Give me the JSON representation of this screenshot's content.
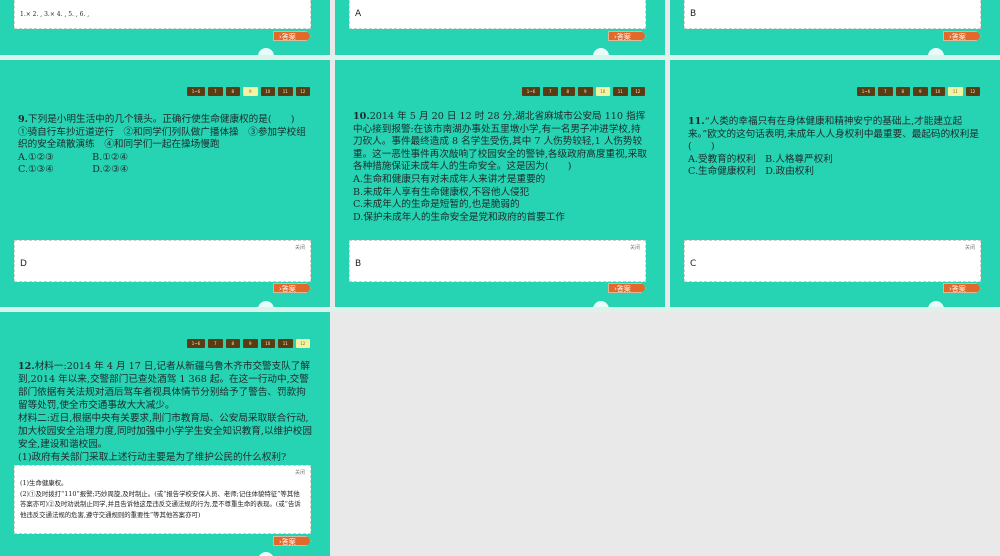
{
  "nav_labels": [
    "1~6",
    "7",
    "8",
    "9",
    "10",
    "11",
    "12"
  ],
  "close_label": "关闭",
  "answer_button": "›答案",
  "top_row": [
    {
      "answer": "1.×   2.  ,  3.×   4.  ,  5.  ,  6.  ,"
    },
    {
      "answer": "A"
    },
    {
      "answer": "B"
    }
  ],
  "slides": [
    {
      "number": "9.",
      "active": 3,
      "lines": [
        "下列是小明生活中的几个镜头。正确行使生命健康权的是(　　)",
        "①骑自行车抄近道逆行　②和同学们列队做广播体操　③参加学校组织的安全疏散演练　④和同学们一起在操场慢跑",
        "A.①②③　　　　B.①②④",
        "C.①③④　　　　D.②③④"
      ],
      "answer": "D"
    },
    {
      "number": "10.",
      "active": 4,
      "lines": [
        "2014 年 5 月 20 日 12 时 28 分,湖北省麻城市公安局 110 指挥中心接到报警:在该市南湖办事处五里墩小学,有一名男子冲进学校,持刀砍人。事件最终造成 8 名学生受伤,其中 7 人伤势较轻,1 人伤势较重。这一恶性事件再次敲响了校园安全的警钟,各级政府高度重视,采取各种措施保证未成年人的生命安全。这是因为(　　)",
        "A.生命和健康只有对未成年人来讲才是重要的",
        "B.未成年人享有生命健康权,不容他人侵犯",
        "C.未成年人的生命是短暂的,也是脆弱的",
        "D.保护未成年人的生命安全是党和政府的首要工作"
      ],
      "answer": "B"
    },
    {
      "number": "11.",
      "active": 5,
      "lines": [
        "“人类的幸福只有在身体健康和精神安宁的基础上,才能建立起来。”欧文的这句话表明,未成年人人身权利中最重要、最起码的权利是(　　)",
        "A.受教育的权利　B.人格尊严权利",
        "C.生命健康权利　D.政由权利"
      ],
      "answer": "C"
    }
  ],
  "slide12": {
    "number": "12.",
    "active": 6,
    "lines": [
      "材料一:2014 年 4 月 17 日,记者从新疆乌鲁木齐市交警支队了解到,2014 年以来,交警部门已查处酒驾 1 368 起。在这一行动中,交警部门依据有关法规对酒后驾车者视具体情节分别给予了警告、罚款拘留等处罚,使全市交通事故大大减少。",
      "材料二:近日,根据中央有关要求,荆门市教育局、公安局采取联合行动,加大校园安全治理力度,同时加强中小学学生安全知识教育,以维护校园安全,建设和谐校园。",
      "(1)政府有关部门采取上述行动主要是为了维护公民的什么权利?"
    ],
    "answer_lines": [
      "(1)生命健康权。",
      "(2)①及时拨打“110”报警;巧妙周旋,及时制止。(或“报告学校安保人员、老师;记住体貌特征”等其他答案亦可)②及时劝说制止同学,并且告诉他这是违反交通法规的行为,是不尊重生命的表现。(或“告诉他违反交通法规的危害,遵守交通规则的重要性”等其他答案亦可)"
    ]
  },
  "colors": {
    "slide_bg": "#26d3b3",
    "nav_bg": "#5b3b12",
    "nav_active": "#f6f2a4",
    "answer_btn": "#e2692a"
  }
}
